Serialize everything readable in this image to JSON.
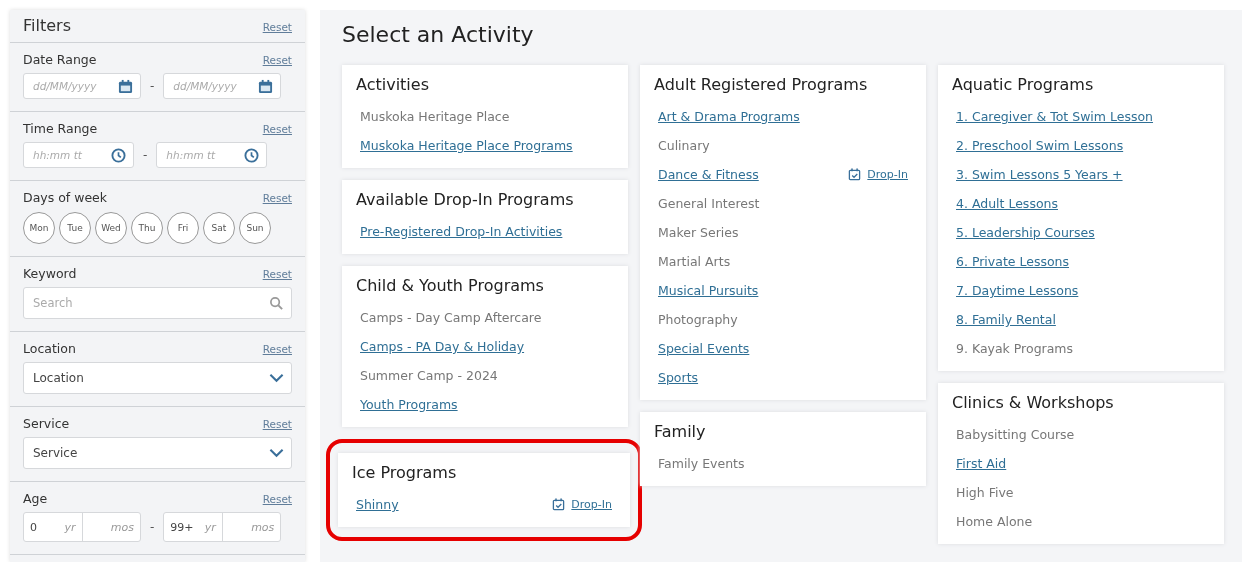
{
  "filters": {
    "title": "Filters",
    "reset": "Reset",
    "sections": [
      {
        "kind": "date",
        "label": "Date Range",
        "reset": "Reset",
        "from": {
          "placeholder": "dd/MM/yyyy"
        },
        "separator": "-",
        "to": {
          "placeholder": "dd/MM/yyyy"
        }
      },
      {
        "kind": "time",
        "label": "Time Range",
        "reset": "Reset",
        "from": {
          "placeholder": "hh:mm tt"
        },
        "separator": "-",
        "to": {
          "placeholder": "hh:mm tt"
        }
      },
      {
        "kind": "days",
        "label": "Days of week",
        "reset": "Reset",
        "days": [
          {
            "label": "Mon",
            "selected": false
          },
          {
            "label": "Tue",
            "selected": false
          },
          {
            "label": "Wed",
            "selected": false
          },
          {
            "label": "Thu",
            "selected": false
          },
          {
            "label": "Fri",
            "selected": false
          },
          {
            "label": "Sat",
            "selected": false
          },
          {
            "label": "Sun",
            "selected": false
          }
        ]
      },
      {
        "kind": "keyword",
        "label": "Keyword",
        "reset": "Reset",
        "placeholder": "Search"
      },
      {
        "kind": "select",
        "label": "Location",
        "reset": "Reset",
        "value": "Location"
      },
      {
        "kind": "select",
        "label": "Service",
        "reset": "Reset",
        "value": "Service"
      },
      {
        "kind": "age",
        "label": "Age",
        "reset": "Reset",
        "from": {
          "years": "0",
          "years_unit": "yr",
          "months_unit": "mos"
        },
        "separator": "-",
        "to": {
          "years": "99+",
          "years_unit": "yr",
          "months_unit": "mos"
        }
      }
    ]
  },
  "main": {
    "title": "Select an Activity",
    "columns": [
      [
        {
          "title": "Activities",
          "highlighted": false,
          "items": [
            {
              "label": "Muskoka Heritage Place",
              "link": false
            },
            {
              "label": "Muskoka Heritage Place Programs",
              "link": true
            }
          ]
        },
        {
          "title": "Available Drop-In Programs",
          "highlighted": false,
          "items": [
            {
              "label": "Pre-Registered Drop-In Activities",
              "link": true
            }
          ]
        },
        {
          "title": "Child & Youth Programs",
          "highlighted": false,
          "items": [
            {
              "label": "Camps - Day Camp Aftercare",
              "link": false
            },
            {
              "label": "Camps - PA Day & Holiday",
              "link": true
            },
            {
              "label": "Summer Camp - 2024",
              "link": false
            },
            {
              "label": "Youth Programs",
              "link": true
            }
          ]
        },
        {
          "title": "Ice Programs",
          "highlighted": true,
          "items": [
            {
              "label": "Shinny",
              "link": true,
              "drop_in": "Drop-In"
            }
          ]
        }
      ],
      [
        {
          "title": "Adult Registered Programs",
          "highlighted": false,
          "items": [
            {
              "label": "Art & Drama Programs",
              "link": true
            },
            {
              "label": "Culinary",
              "link": false
            },
            {
              "label": "Dance & Fitness",
              "link": true,
              "drop_in": "Drop-In"
            },
            {
              "label": "General Interest",
              "link": false
            },
            {
              "label": "Maker Series",
              "link": false
            },
            {
              "label": "Martial Arts",
              "link": false
            },
            {
              "label": "Musical Pursuits",
              "link": true
            },
            {
              "label": "Photography",
              "link": false
            },
            {
              "label": "Special Events",
              "link": true
            },
            {
              "label": "Sports",
              "link": true
            }
          ]
        },
        {
          "title": "Family",
          "highlighted": false,
          "items": [
            {
              "label": "Family Events",
              "link": false
            }
          ]
        }
      ],
      [
        {
          "title": "Aquatic Programs",
          "highlighted": false,
          "items": [
            {
              "label": "1. Caregiver & Tot Swim Lesson",
              "link": true
            },
            {
              "label": "2. Preschool Swim Lessons",
              "link": true
            },
            {
              "label": "3. Swim Lessons 5 Years +",
              "link": true
            },
            {
              "label": "4. Adult Lessons",
              "link": true
            },
            {
              "label": "5. Leadership Courses",
              "link": true
            },
            {
              "label": "6. Private Lessons",
              "link": true
            },
            {
              "label": "7. Daytime Lessons",
              "link": true
            },
            {
              "label": "8. Family Rental",
              "link": true
            },
            {
              "label": "9. Kayak Programs",
              "link": false
            }
          ]
        },
        {
          "title": "Clinics & Workshops",
          "highlighted": false,
          "items": [
            {
              "label": "Babysitting Course",
              "link": false
            },
            {
              "label": "First Aid",
              "link": true
            },
            {
              "label": "High Five",
              "link": false
            },
            {
              "label": "Home Alone",
              "link": false
            }
          ]
        }
      ]
    ]
  }
}
